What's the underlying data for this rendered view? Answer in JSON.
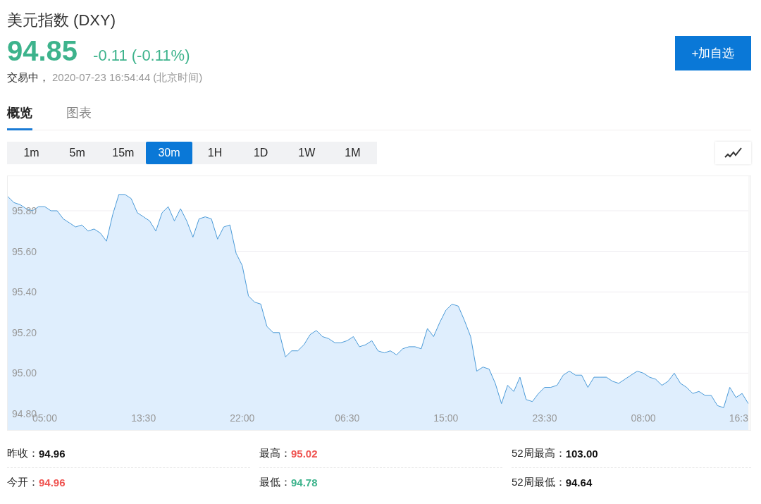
{
  "header": {
    "title": "美元指数 (DXY)",
    "price": "94.85",
    "change": "-0.11 (-0.11%)",
    "status": "交易中，",
    "timestamp": "2020-07-23 16:54:44",
    "timezone": "(北京时间)",
    "watch_button": "+加自选"
  },
  "tabs": [
    {
      "label": "概览",
      "selected": true
    },
    {
      "label": "图表",
      "selected": false
    }
  ],
  "intervals": [
    {
      "label": "1m",
      "selected": false
    },
    {
      "label": "5m",
      "selected": false
    },
    {
      "label": "15m",
      "selected": false
    },
    {
      "label": "30m",
      "selected": true
    },
    {
      "label": "1H",
      "selected": false
    },
    {
      "label": "1D",
      "selected": false
    },
    {
      "label": "1W",
      "selected": false
    },
    {
      "label": "1M",
      "selected": false
    }
  ],
  "chart": {
    "chart_data": {
      "type": "area",
      "grid": true,
      "ylim": [
        94.72,
        95.97
      ],
      "categories": [
        null,
        null,
        null,
        null,
        null,
        null,
        "05:00",
        null,
        null,
        null,
        null,
        null,
        null,
        null,
        null,
        null,
        null,
        null,
        null,
        null,
        null,
        null,
        "13:30",
        null,
        null,
        null,
        null,
        null,
        null,
        null,
        null,
        null,
        null,
        null,
        null,
        null,
        null,
        null,
        "22:00",
        null,
        null,
        null,
        null,
        null,
        null,
        null,
        null,
        null,
        null,
        null,
        null,
        null,
        null,
        null,
        null,
        "06:30",
        null,
        null,
        null,
        null,
        null,
        null,
        null,
        null,
        null,
        null,
        null,
        null,
        null,
        null,
        null,
        "15:00",
        null,
        null,
        null,
        null,
        null,
        null,
        null,
        null,
        null,
        null,
        null,
        null,
        null,
        null,
        null,
        "23:30",
        null,
        null,
        null,
        null,
        null,
        null,
        null,
        null,
        null,
        null,
        null,
        null,
        null,
        null,
        null,
        "08:00",
        null,
        null,
        null,
        null,
        null,
        null,
        null,
        null,
        null,
        null,
        null,
        null,
        null,
        null,
        null,
        "16:3",
        null
      ],
      "yticks": [
        {
          "value": 94.8,
          "label": "94.80"
        },
        {
          "value": 95.0,
          "label": "95.00"
        },
        {
          "value": 95.2,
          "label": "95.20"
        },
        {
          "value": 95.4,
          "label": "95.40"
        },
        {
          "value": 95.6,
          "label": "95.60"
        },
        {
          "value": 95.8,
          "label": "95.80"
        }
      ],
      "series": [
        {
          "color": "#4a9ad8",
          "values": [
            95.87,
            95.84,
            95.83,
            95.81,
            95.8,
            95.82,
            95.82,
            95.8,
            95.8,
            95.76,
            95.74,
            95.72,
            95.73,
            95.7,
            95.71,
            95.69,
            95.65,
            95.78,
            95.88,
            95.88,
            95.86,
            95.79,
            95.77,
            95.75,
            95.7,
            95.79,
            95.82,
            95.75,
            95.81,
            95.75,
            95.67,
            95.76,
            95.77,
            95.76,
            95.66,
            95.72,
            95.73,
            95.59,
            95.53,
            95.38,
            95.35,
            95.34,
            95.23,
            95.2,
            95.2,
            95.08,
            95.11,
            95.11,
            95.14,
            95.19,
            95.21,
            95.18,
            95.17,
            95.15,
            95.15,
            95.16,
            95.18,
            95.13,
            95.14,
            95.16,
            95.11,
            95.1,
            95.11,
            95.09,
            95.12,
            95.13,
            95.13,
            95.12,
            95.22,
            95.18,
            95.25,
            95.31,
            95.34,
            95.33,
            95.26,
            95.18,
            95.01,
            95.03,
            95.02,
            94.95,
            94.85,
            94.94,
            94.91,
            94.98,
            94.87,
            94.86,
            94.9,
            94.93,
            94.93,
            94.94,
            94.99,
            95.01,
            94.99,
            94.99,
            94.93,
            94.98,
            94.98,
            94.98,
            94.96,
            94.95,
            94.97,
            94.99,
            95.01,
            95.0,
            94.98,
            94.97,
            94.94,
            94.96,
            95.0,
            94.95,
            94.93,
            94.9,
            94.91,
            94.89,
            94.89,
            94.84,
            94.83,
            94.93,
            94.88,
            94.9,
            94.85
          ]
        }
      ]
    }
  },
  "stats": [
    {
      "label": "昨收：",
      "value": "94.96",
      "color": "#111111"
    },
    {
      "label": "最高：",
      "value": "95.02",
      "color": "#ef5350"
    },
    {
      "label": "52周最高：",
      "value": "103.00",
      "color": "#111111"
    },
    {
      "label": "今开：",
      "value": "94.96",
      "color": "#ef5350"
    },
    {
      "label": "最低：",
      "value": "94.78",
      "color": "#3db38c"
    },
    {
      "label": "52周最低：",
      "value": "94.64",
      "color": "#111111"
    }
  ]
}
